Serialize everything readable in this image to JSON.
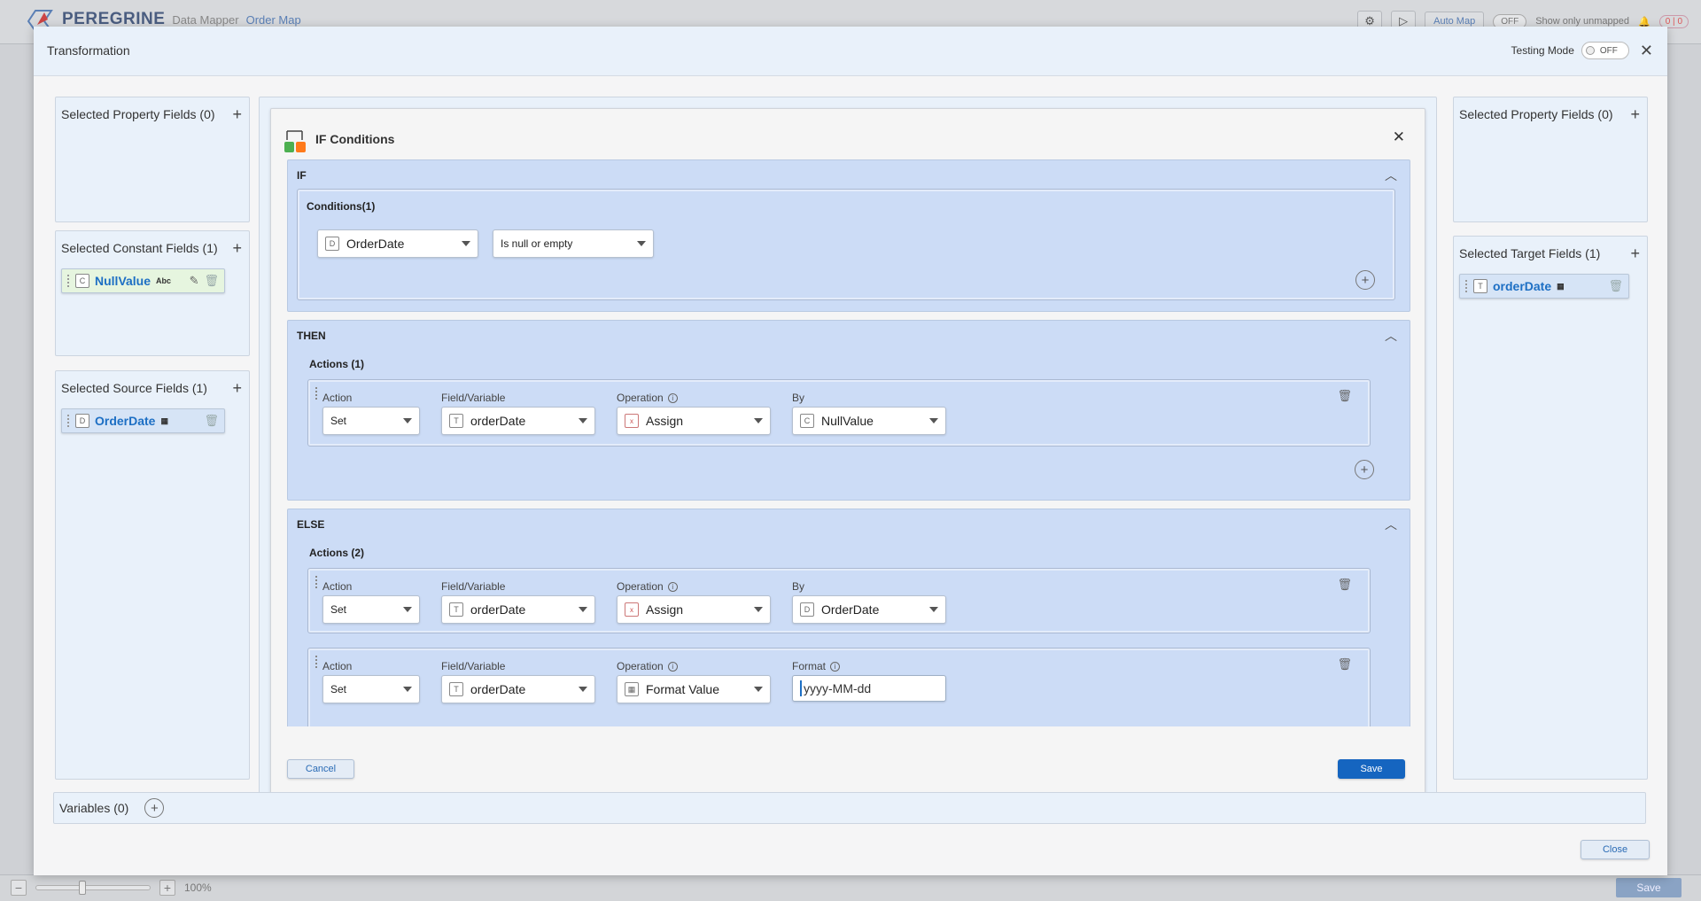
{
  "background": {
    "brand": "PEREGRINE",
    "app": "Data Mapper",
    "map_name": "Order Map",
    "auto_map": "Auto Map",
    "toggle_off": "OFF",
    "show_unmapped": "Show only unmapped",
    "count_a": "0",
    "count_b": "0",
    "zoom": "100%",
    "save": "Save"
  },
  "modal": {
    "title": "Transformation",
    "testing_mode_label": "Testing Mode",
    "testing_mode_value": "OFF",
    "close_label": "Close"
  },
  "left": {
    "property_fields": "Selected Property Fields (0)",
    "constant_fields": "Selected Constant Fields (1)",
    "constant_chip": {
      "name": "NullValue",
      "type": "Abc"
    },
    "source_fields": "Selected Source Fields (1)",
    "source_chip": {
      "name": "OrderDate"
    }
  },
  "right": {
    "property_fields": "Selected Property Fields (0)",
    "target_fields": "Selected Target Fields (1)",
    "target_chip": {
      "name": "orderDate"
    }
  },
  "ifc": {
    "title": "IF Conditions",
    "if_label": "IF",
    "conditions_label": "Conditions(1)",
    "condition": {
      "field": "OrderDate",
      "operator": "Is null or empty"
    },
    "then_label": "THEN",
    "then_actions_label": "Actions (1)",
    "else_label": "ELSE",
    "else_actions_label": "Actions (2)",
    "col_action": "Action",
    "col_field": "Field/Variable",
    "col_operation": "Operation",
    "col_by": "By",
    "col_format": "Format",
    "then_row": {
      "action": "Set",
      "field": "orderDate",
      "operation": "Assign",
      "by": "NullValue"
    },
    "else_row1": {
      "action": "Set",
      "field": "orderDate",
      "operation": "Assign",
      "by": "OrderDate"
    },
    "else_row2": {
      "action": "Set",
      "field": "orderDate",
      "operation": "Format Value",
      "format": "yyyy-MM-dd"
    },
    "cancel": "Cancel",
    "save": "Save"
  },
  "variables": {
    "label": "Variables (0)"
  }
}
